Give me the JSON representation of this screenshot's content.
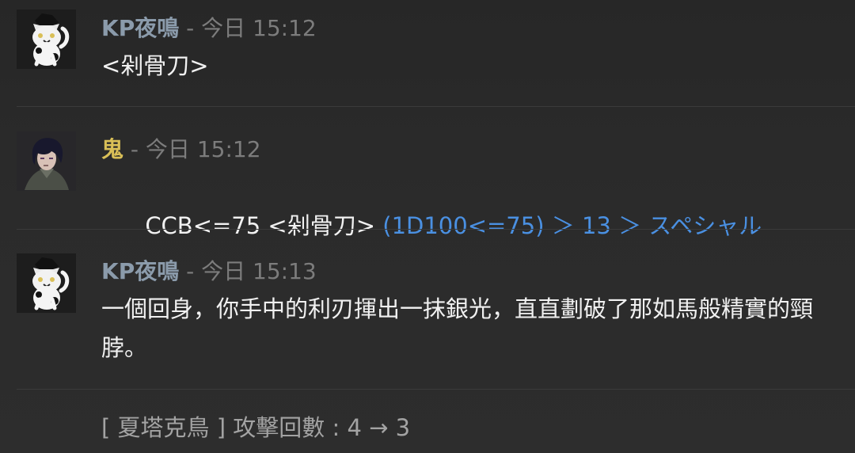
{
  "messages": [
    {
      "author": "KP夜鳴",
      "separator": " - ",
      "time": "今日 15:12",
      "text": "<剁骨刀>"
    },
    {
      "author": "鬼",
      "separator": " - ",
      "time": "今日 15:12",
      "text": "CCB<=75 <剁骨刀> ",
      "dice_result": "(1D100<=75) ＞ 13 ＞ スペシャル"
    },
    {
      "author": "KP夜鳴",
      "separator": " - ",
      "time": "今日 15:13",
      "text": "一個回身，你手中的利刃揮出一抹銀光，直直劃破了那如馬般精實的頸脖。"
    }
  ],
  "system_message": "[ 夏塔克鳥 ] 攻擊回數 : 4 → 3",
  "icons": {
    "kp_avatar": "cat-avatar-icon",
    "oni_avatar": "dark-haired-character-avatar-icon"
  },
  "colors": {
    "background": "#2a2a2a",
    "kp_name": "#8b9bab",
    "oni_name": "#d9bf57",
    "dice_result": "#4a90e2",
    "body_text": "#f1f1f1",
    "muted_text": "#7c7c7c"
  }
}
